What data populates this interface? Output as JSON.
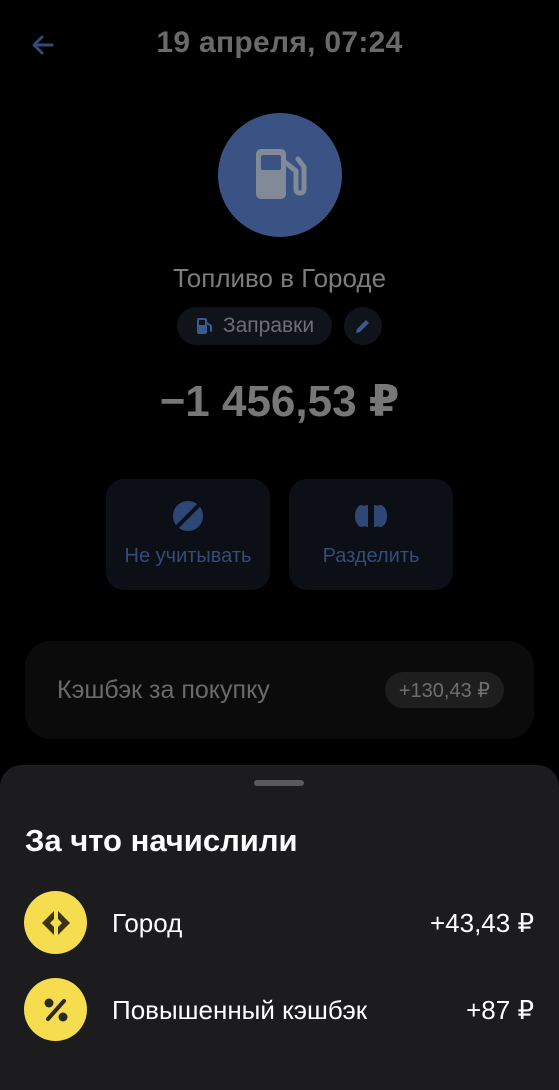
{
  "header": {
    "title": "19 апреля, 07:24",
    "back_icon": "arrow-left-icon"
  },
  "merchant": {
    "name": "Топливо в Городе",
    "avatar_icon": "fuel-pump-icon",
    "category": "Заправки",
    "category_icon": "fuel-pump-icon",
    "edit_icon": "pencil-icon"
  },
  "transaction": {
    "amount": "−1 456,53 ₽"
  },
  "actions": {
    "ignore_label": "Не учитывать",
    "ignore_icon": "eye-off-icon",
    "split_label": "Разделить",
    "split_icon": "split-icon"
  },
  "cashback": {
    "label": "Кэшбэк за покупку",
    "value": "+130,43 ₽"
  },
  "sheet": {
    "title": "За что начислили",
    "items": [
      {
        "name": "Город",
        "value": "+43,43 ₽",
        "icon": "city-diamond-icon"
      },
      {
        "name": "Повышенный кэшбэк",
        "value": "+87 ₽",
        "icon": "percent-icon"
      }
    ]
  },
  "colors": {
    "accent": "#4a6fb5",
    "badge_yellow": "#f5dd4f",
    "sheet_bg": "#1c1c1e",
    "background": "#000000"
  }
}
